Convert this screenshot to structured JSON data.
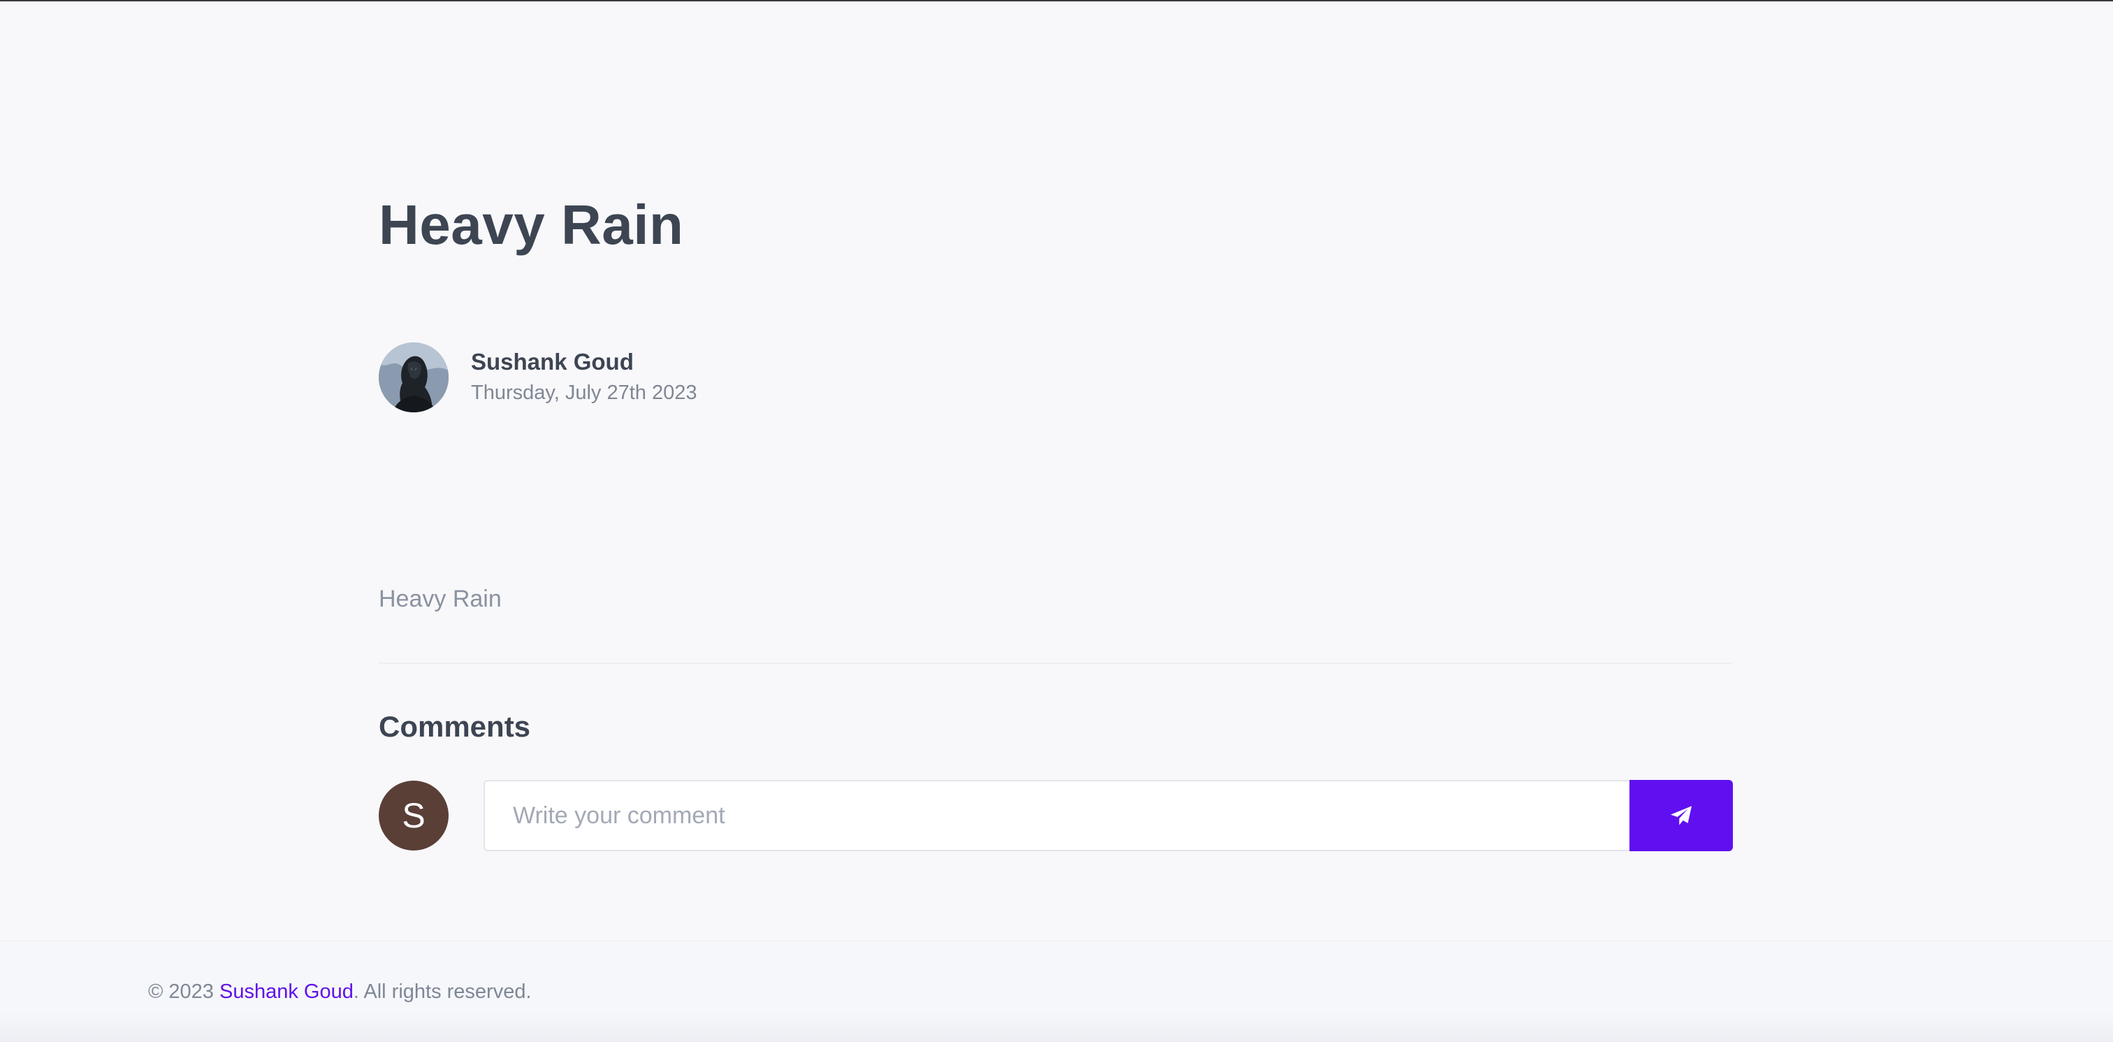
{
  "post": {
    "title": "Heavy Rain",
    "author_name": "Sushank Goud",
    "date": "Thursday, July 27th 2023",
    "body": "Heavy Rain"
  },
  "comments": {
    "heading": "Comments",
    "user_initial": "S",
    "input_placeholder": "Write your comment",
    "send_icon": "paper-plane-icon"
  },
  "footer": {
    "prefix": "© 2023 ",
    "link_text": "Sushank Goud",
    "suffix": ". All rights reserved."
  },
  "colors": {
    "accent": "#6010f0",
    "user_avatar_bg": "#5a3f37",
    "heading": "#3d4553",
    "muted": "#7f8795"
  }
}
